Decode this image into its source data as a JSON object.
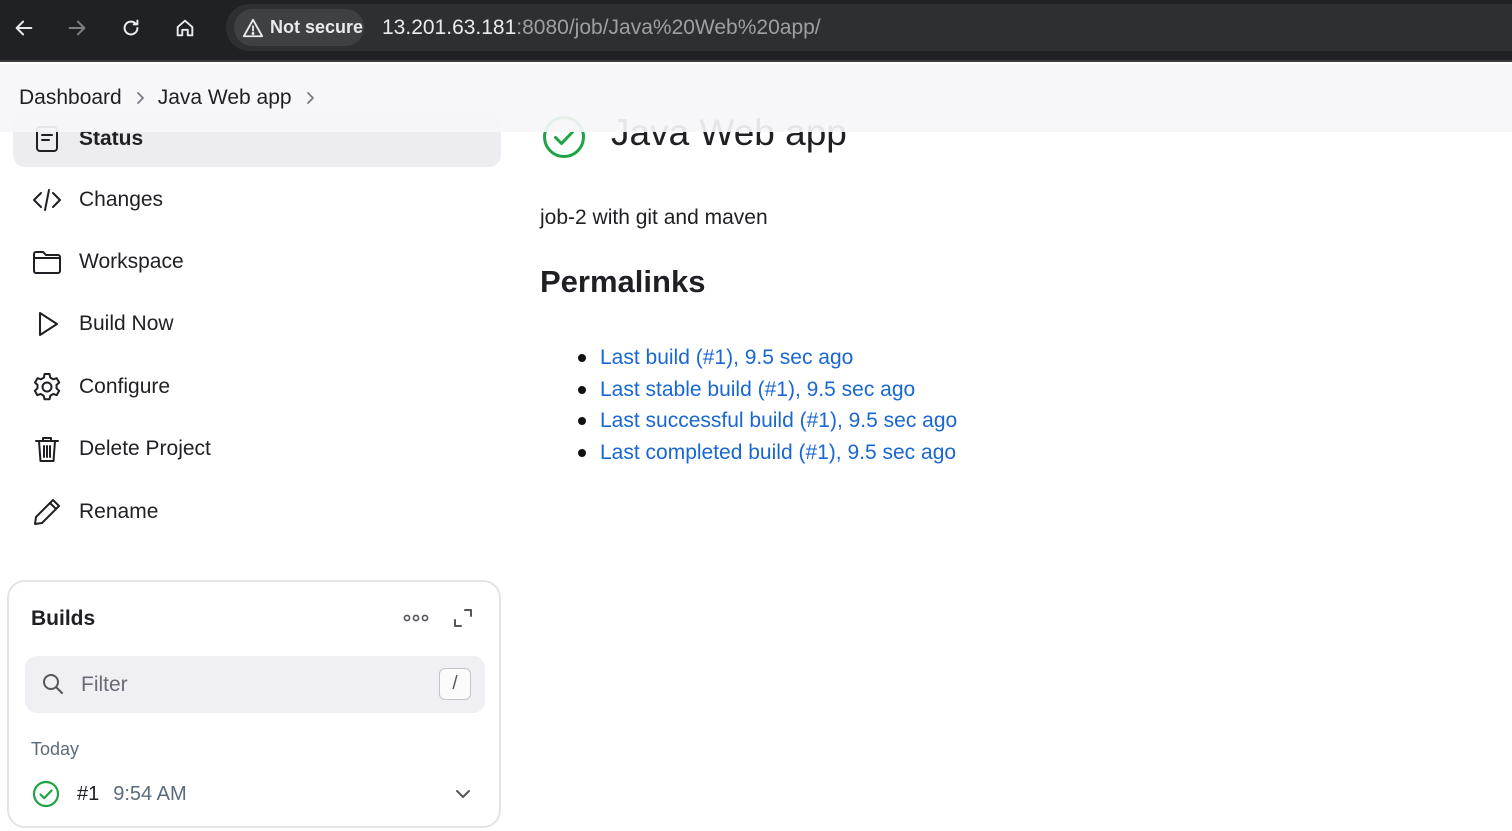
{
  "browser": {
    "security_label": "Not secure",
    "url_host": "13.201.63.181",
    "url_path": ":8080/job/Java%20Web%20app/"
  },
  "breadcrumb": {
    "items": [
      "Dashboard",
      "Java Web app"
    ]
  },
  "sidebar": {
    "items": [
      {
        "label": "Status",
        "icon": "status-icon",
        "active": true
      },
      {
        "label": "Changes",
        "icon": "code-icon"
      },
      {
        "label": "Workspace",
        "icon": "folder-icon"
      },
      {
        "label": "Build Now",
        "icon": "play-icon"
      },
      {
        "label": "Configure",
        "icon": "gear-icon"
      },
      {
        "label": "Delete Project",
        "icon": "trash-icon"
      },
      {
        "label": "Rename",
        "icon": "pencil-icon"
      }
    ]
  },
  "builds": {
    "title": "Builds",
    "filter_placeholder": "Filter",
    "shortcut_key": "/",
    "group_label": "Today",
    "rows": [
      {
        "number": "#1",
        "time": "9:54 AM",
        "status": "success"
      }
    ]
  },
  "main": {
    "title": "Java Web app",
    "description": "job-2 with git and maven",
    "permalinks_heading": "Permalinks",
    "permalinks": [
      "Last build (#1), 9.5 sec ago",
      "Last stable build (#1), 9.5 sec ago",
      "Last successful build (#1), 9.5 sec ago",
      "Last completed build (#1), 9.5 sec ago"
    ]
  },
  "colors": {
    "success": "#1ea446",
    "link": "#1967d2",
    "browser_bg": "#202124"
  }
}
